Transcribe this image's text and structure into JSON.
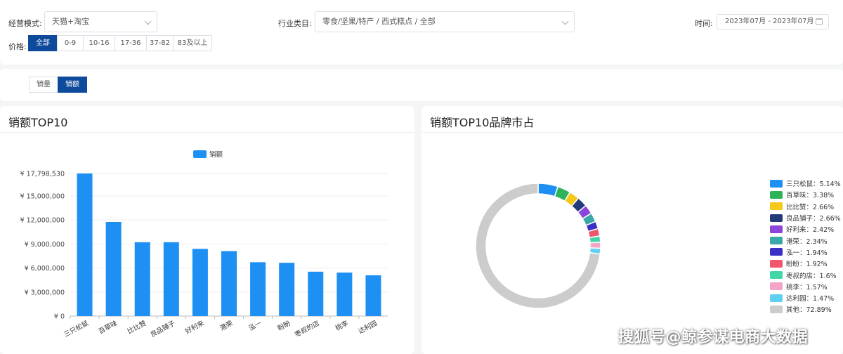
{
  "filters": {
    "mode_label": "经营模式:",
    "mode_value": "天猫+淘宝",
    "industry_label": "行业类目:",
    "industry_value": "零食/坚果/特产 / 西式糕点 / 全部",
    "time_label": "时间:",
    "time_value": "2023年07月 - 2023年07月",
    "price_label": "价格:",
    "price_options": [
      "全部",
      "0-9",
      "10-16",
      "17-36",
      "37-82",
      "83及以上"
    ],
    "price_selected": "全部"
  },
  "metric_toggle": {
    "options": [
      "销量",
      "销额"
    ],
    "selected": "销额"
  },
  "left_card": {
    "title": "销额TOP10"
  },
  "right_card": {
    "title": "销额TOP10品牌市占"
  },
  "watermark": "搜狐号@鲸参谋电商大数据",
  "colors": {
    "accent": "#0d4a9b",
    "bar": "#1e8ff3"
  },
  "chart_data": [
    {
      "type": "bar",
      "series": [
        {
          "name": "销额",
          "values": [
            17798530,
            11750000,
            9220000,
            9220000,
            8390000,
            8110000,
            6720000,
            6650000,
            5540000,
            5430000,
            5090000
          ]
        }
      ],
      "categories": [
        "三只松鼠",
        "百草味",
        "比比赞",
        "良品铺子",
        "好利来",
        "港荣",
        "泓一",
        "盼盼",
        "枣叔的店",
        "桃李",
        "达利园"
      ],
      "yticks": [
        "¥ 0",
        "¥ 3,000,000",
        "¥ 6,000,000",
        "¥ 9,000,000",
        "¥ 12,000,000",
        "¥ 15,000,000",
        "¥ 17,798,530"
      ],
      "ylim": [
        0,
        17798530
      ],
      "legend": "top-center",
      "color": "#1e8ff3"
    },
    {
      "type": "pie",
      "style": "donut",
      "slices": [
        {
          "name": "三只松鼠",
          "value": 5.14,
          "label": "三只松鼠：5.14%",
          "color": "#1e8ff3"
        },
        {
          "name": "百草味",
          "value": 3.38,
          "label": "百草味：3.38%",
          "color": "#2db35a"
        },
        {
          "name": "比比赞",
          "value": 2.66,
          "label": "比比赞：2.66%",
          "color": "#f6c81c"
        },
        {
          "name": "良品铺子",
          "value": 2.66,
          "label": "良品铺子：2.66%",
          "color": "#243b7a"
        },
        {
          "name": "好利来",
          "value": 2.42,
          "label": "好利来：2.42%",
          "color": "#8b45d9"
        },
        {
          "name": "港荣",
          "value": 2.34,
          "label": "港荣：2.34%",
          "color": "#3aa8a8"
        },
        {
          "name": "泓一",
          "value": 1.94,
          "label": "泓一：1.94%",
          "color": "#3a2fc6"
        },
        {
          "name": "盼盼",
          "value": 1.92,
          "label": "盼盼：1.92%",
          "color": "#f0566c"
        },
        {
          "name": "枣叔的店",
          "value": 1.6,
          "label": "枣叔的店：1.6%",
          "color": "#41d6a8"
        },
        {
          "name": "桃李",
          "value": 1.57,
          "label": "桃李：1.57%",
          "color": "#f5a3c7"
        },
        {
          "name": "达利园",
          "value": 1.47,
          "label": "达利园：1.47%",
          "color": "#5fd0f0"
        },
        {
          "name": "其他",
          "value": 72.89,
          "label": "其他：72.89%",
          "color": "#cccccc"
        }
      ],
      "legend": "right"
    }
  ]
}
